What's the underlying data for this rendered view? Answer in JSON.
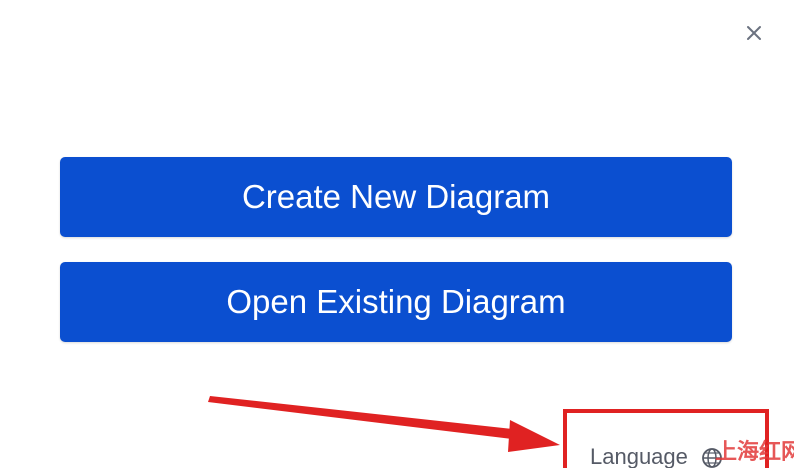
{
  "dialog": {
    "close_icon": "close-icon",
    "create_label": "Create New Diagram",
    "open_label": "Open Existing Diagram",
    "language_label": "Language",
    "language_icon": "globe-icon"
  },
  "annotation": {
    "highlight_color": "#e02222",
    "arrow_color": "#e02222"
  },
  "watermark": {
    "text": "上海红网"
  },
  "theme": {
    "button_color": "#0b4fd0",
    "button_text_color": "#ffffff",
    "background": "#ffffff"
  }
}
